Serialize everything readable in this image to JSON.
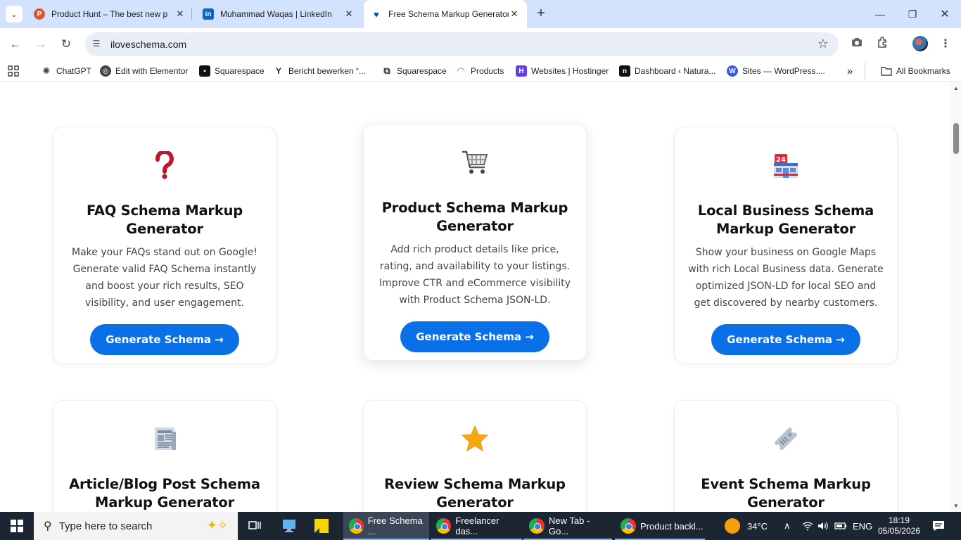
{
  "browser": {
    "tabs": [
      {
        "title": "Product Hunt – The best new p",
        "icon": "product-hunt-icon",
        "color": "#da552f",
        "letter": "P"
      },
      {
        "title": "Muhammad Waqas | LinkedIn",
        "icon": "linkedin-icon",
        "color": "#0a66c2",
        "letter": "in"
      },
      {
        "title": "Free Schema Markup Generator",
        "icon": "heart-icon",
        "color": "#0a4ea8",
        "letter": "♥"
      }
    ],
    "url": "iloveschema.com",
    "bookmarks": [
      {
        "label": "ChatGPT",
        "icon": "chatgpt-icon"
      },
      {
        "label": "Edit with Elementor",
        "icon": "globe-icon"
      },
      {
        "label": "Squarespace",
        "icon": "squarespace-icon"
      },
      {
        "label": "Bericht bewerken “...",
        "icon": "yoast-icon"
      },
      {
        "label": "Squarespace",
        "icon": "squarespace-icon"
      },
      {
        "label": "Products",
        "icon": "products-icon"
      },
      {
        "label": "Websites | Hostinger",
        "icon": "hostinger-icon"
      },
      {
        "label": "Dashboard ‹ Natura...",
        "icon": "notion-icon"
      },
      {
        "label": "Sites — WordPress....",
        "icon": "wordpress-icon"
      }
    ],
    "all_bookmarks": "All Bookmarks",
    "overflow": "»"
  },
  "cards": [
    {
      "icon": "question-mark-icon",
      "glyph": "❓",
      "title": "FAQ Schema Markup Generator",
      "desc": "Make your FAQs stand out on Google! Generate valid FAQ Schema instantly and boost your rich results, SEO visibility, and user engagement.",
      "button": "Generate Schema →"
    },
    {
      "icon": "shopping-cart-icon",
      "glyph": "🛒",
      "title": "Product Schema Markup Generator",
      "desc": "Add rich product details like price, rating, and availability to your listings. Improve CTR and eCommerce visibility with Product Schema JSON-LD.",
      "button": "Generate Schema →"
    },
    {
      "icon": "convenience-store-icon",
      "glyph": "🏪",
      "title": "Local Business Schema Markup Generator",
      "desc": "Show your business on Google Maps with rich Local Business data. Generate optimized JSON-LD for local SEO and get discovered by nearby customers.",
      "button": "Generate Schema →"
    },
    {
      "icon": "newspaper-icon",
      "glyph": "📰",
      "title": "Article/Blog Post Schema Markup Generator"
    },
    {
      "icon": "star-icon",
      "glyph": "⭐",
      "title": "Review Schema Markup Generator"
    },
    {
      "icon": "ticket-icon",
      "glyph": "🎟",
      "title": "Event Schema Markup Generator"
    }
  ],
  "taskbar": {
    "search_placeholder": "Type here to search",
    "tasks": [
      {
        "label": "Free Schema ...",
        "active": true
      },
      {
        "label": "Freelancer das...",
        "active": false
      },
      {
        "label": "New Tab - Go...",
        "active": false
      },
      {
        "label": "Product backl...",
        "active": false
      }
    ],
    "weather": "34°C",
    "language": "ENG",
    "time": "18:19",
    "date": "05/05/2026"
  }
}
